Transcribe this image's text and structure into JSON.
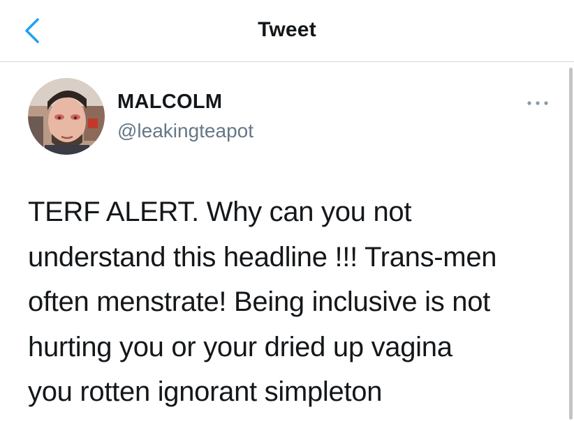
{
  "header": {
    "title": "Tweet",
    "back_icon": "chevron-left-icon"
  },
  "tweet": {
    "display_name": "MALCOLM",
    "handle": "@leakingteapot",
    "more_icon": "ellipsis-icon",
    "text_lines": [
      "TERF ALERT. Why can you not",
      "understand this headline !!! Trans-men",
      "often menstrate! Being inclusive is not",
      "hurting you or your dried up vagina",
      "you rotten ignorant simpleton"
    ]
  },
  "colors": {
    "accent": "#1da1f2",
    "text": "#14171a",
    "secondary_text": "#657786",
    "divider": "#d6d6d6"
  }
}
